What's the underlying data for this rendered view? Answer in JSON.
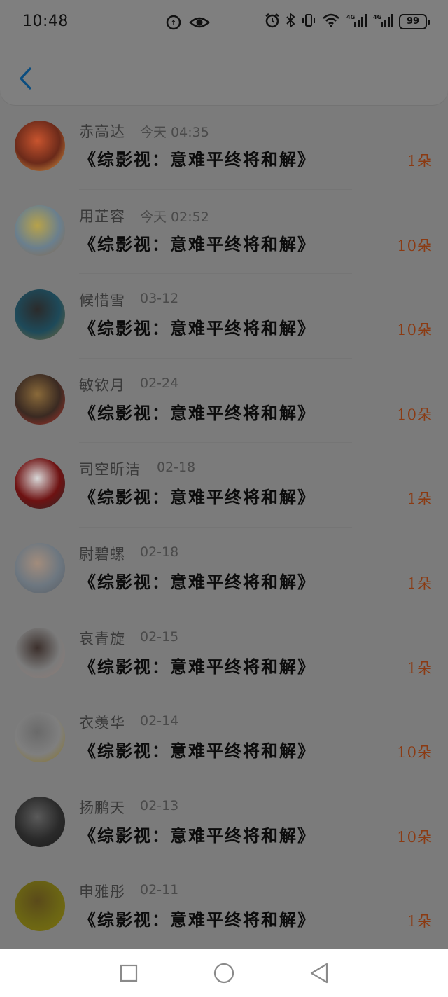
{
  "status_bar": {
    "time": "10:48",
    "battery": "99"
  },
  "header": {
    "back_icon": "chevron-left-icon"
  },
  "list": [
    {
      "name": "赤高达",
      "time": "今天 04:35",
      "title": "《综影视：意难平终将和解》",
      "count": "1朵",
      "avatar_colors": [
        "#6b2a1a",
        "#c8542e",
        "#e0a048"
      ]
    },
    {
      "name": "用芷容",
      "time": "今天 02:52",
      "title": "《综影视：意难平终将和解》",
      "count": "10朵",
      "avatar_colors": [
        "#6a7f8e",
        "#b7a24a",
        "#8a6a4a"
      ]
    },
    {
      "name": "候惜雪",
      "time": "03-12",
      "title": "《综影视：意难平终将和解》",
      "count": "10朵",
      "avatar_colors": [
        "#1e4a5a",
        "#2b2b2b",
        "#7a6a3a"
      ]
    },
    {
      "name": "敏钦月",
      "time": "02-24",
      "title": "《综影视：意难平终将和解》",
      "count": "10朵",
      "avatar_colors": [
        "#3a2a22",
        "#8a6a3a",
        "#b0322a"
      ]
    },
    {
      "name": "司空昕洁",
      "time": "02-18",
      "title": "《综影视：意难平终将和解》",
      "count": "1朵",
      "avatar_colors": [
        "#6e1212",
        "#d8d8d8",
        "#2a2a2a"
      ]
    },
    {
      "name": "尉碧螺",
      "time": "02-18",
      "title": "《综影视：意难平终将和解》",
      "count": "1朵",
      "avatar_colors": [
        "#6d7780",
        "#a28c7c",
        "#585c63"
      ]
    },
    {
      "name": "哀青旋",
      "time": "02-15",
      "title": "《综影视：意难平终将和解》",
      "count": "1朵",
      "avatar_colors": [
        "#7b7b7b",
        "#3c302c",
        "#8f7c76"
      ]
    },
    {
      "name": "衣羡华",
      "time": "02-14",
      "title": "《综影视：意难平终将和解》",
      "count": "10朵",
      "avatar_colors": [
        "#7f7f7f",
        "#6a6a6a",
        "#8a7420"
      ]
    },
    {
      "name": "扬鹏天",
      "time": "02-13",
      "title": "《综影视：意难平终将和解》",
      "count": "10朵",
      "avatar_colors": [
        "#2a2a2a",
        "#5a5a5a",
        "#1a1a1a"
      ]
    },
    {
      "name": "申雅彤",
      "time": "02-11",
      "title": "《综影视：意难平终将和解》",
      "count": "1朵",
      "avatar_colors": [
        "#6a6414",
        "#5a4a1a",
        "#7a7010"
      ]
    }
  ],
  "nav": {
    "recent_icon": "square-icon",
    "home_icon": "circle-icon",
    "back_icon": "triangle-back-icon"
  }
}
